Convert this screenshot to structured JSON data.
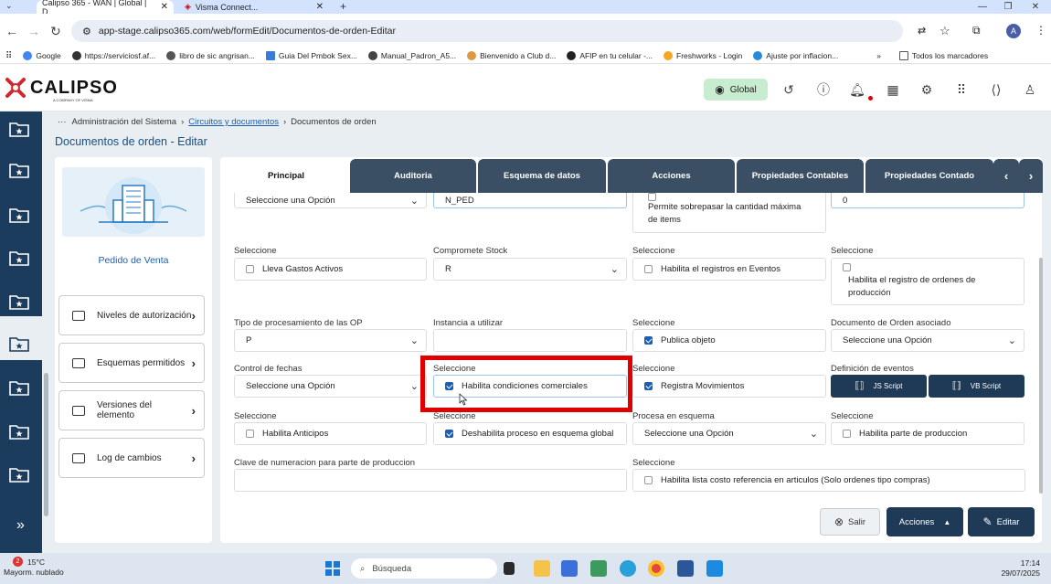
{
  "browser": {
    "tabs": [
      {
        "title": "Calipso 365 - WAN | Global | D...",
        "active": true
      },
      {
        "title": "Visma Connect...",
        "active": false
      }
    ],
    "url": "app-stage.calipso365.com/web/formEdit/Documentos-de-orden-Editar",
    "bookmarks": [
      "Google",
      "https://serviciosf.af...",
      "libro de sic angrisan...",
      "Guia Del Pmbok Sex...",
      "Manual_Padron_A5...",
      "Bienvenido a Club d...",
      "AFIP en tu celular -...",
      "Freshworks - Login",
      "Ajuste por inflacion..."
    ],
    "bookmarks_overflow": "»",
    "all_bookmarks": "Todos los marcadores",
    "profile_initial": "A"
  },
  "app": {
    "logo_text": "CALIPSO",
    "logo_sub": "A COMPANY OF VISMA",
    "env_label": "Global"
  },
  "breadcrumb": {
    "ellipsis": "···",
    "items": [
      "Administración del Sistema",
      "Circuitos y documentos",
      "Documentos de orden"
    ],
    "sep": "›"
  },
  "page_title": "Documentos de orden - Editar",
  "entity": {
    "name": "Pedido de Venta"
  },
  "side_buttons": [
    "Niveles de autorización",
    "Esquemas permitidos",
    "Versiones del elemento",
    "Log de cambios"
  ],
  "tabs": [
    "Principal",
    "Auditoria",
    "Esquema de datos",
    "Acciones",
    "Propiedades Contables",
    "Propiedades Contado"
  ],
  "tab_nav": {
    "prev": "‹",
    "next": "›"
  },
  "form": {
    "row0": {
      "c1_value": "Seleccione una Opción",
      "c2_value": "N_PED",
      "c3_text": "Permite sobrepasar la cantidad máxima de items",
      "c4_value": "0"
    },
    "row1": {
      "c1_label": "Seleccione",
      "c1_text": "Lleva Gastos Activos",
      "c2_label": "Compromete Stock",
      "c2_value": "R",
      "c3_label": "Seleccione",
      "c3_text": "Habilita el registros en Eventos",
      "c4_label": "Seleccione",
      "c4_text": "Habilita el registro de ordenes de producción"
    },
    "row2": {
      "c1_label": "Tipo de procesamiento de las OP",
      "c1_value": "P",
      "c2_label": "Instancia a utilizar",
      "c2_value": "",
      "c3_label": "Seleccione",
      "c3_text": "Publica objeto",
      "c4_label": "Documento de Orden asociado",
      "c4_value": "Seleccione una Opción"
    },
    "row3": {
      "c1_label": "Control de fechas",
      "c1_value": "Seleccione una Opción",
      "c2_label": "Seleccione",
      "c2_text": "Habilita condiciones comerciales",
      "c3_label": "Seleccione",
      "c3_text": "Registra Movimientos",
      "c4_label": "Definición de eventos",
      "js_btn": "JS Script",
      "vb_btn": "VB Script"
    },
    "row4": {
      "c1_label": "Seleccione",
      "c1_text": "Habilita Anticipos",
      "c2_label": "Seleccione",
      "c2_text": "Deshabilita proceso en esquema global",
      "c3_label": "Procesa en esquema",
      "c3_value": "Seleccione una Opción",
      "c4_label": "Seleccione",
      "c4_text": "Habilita parte de produccion"
    },
    "row5": {
      "c1_label": "Clave de numeracion para parte de produccion",
      "c1_value": "",
      "c3_label": "Seleccione",
      "c3_text": "Habilita lista costo referencia en articulos (Solo ordenes tipo compras)"
    },
    "checked": {
      "publica_objeto": true,
      "habilita_condiciones": true,
      "registra_movimientos": true,
      "deshabilita_proceso": true
    }
  },
  "footer": {
    "salir": "Salir",
    "acciones": "Acciones",
    "editar": "Editar"
  },
  "taskbar": {
    "weather_badge": "2",
    "temp": "15°C",
    "weather": "Mayorm. nublado",
    "search": "Búsqueda",
    "time": "17:14",
    "date": "29/07/2025"
  },
  "colors": {
    "nav": "#1b3c5c",
    "tab": "#3a4f64",
    "accent": "#1a5fb4",
    "highlight": "#e00000",
    "env_pill": "#c8ecd0"
  }
}
